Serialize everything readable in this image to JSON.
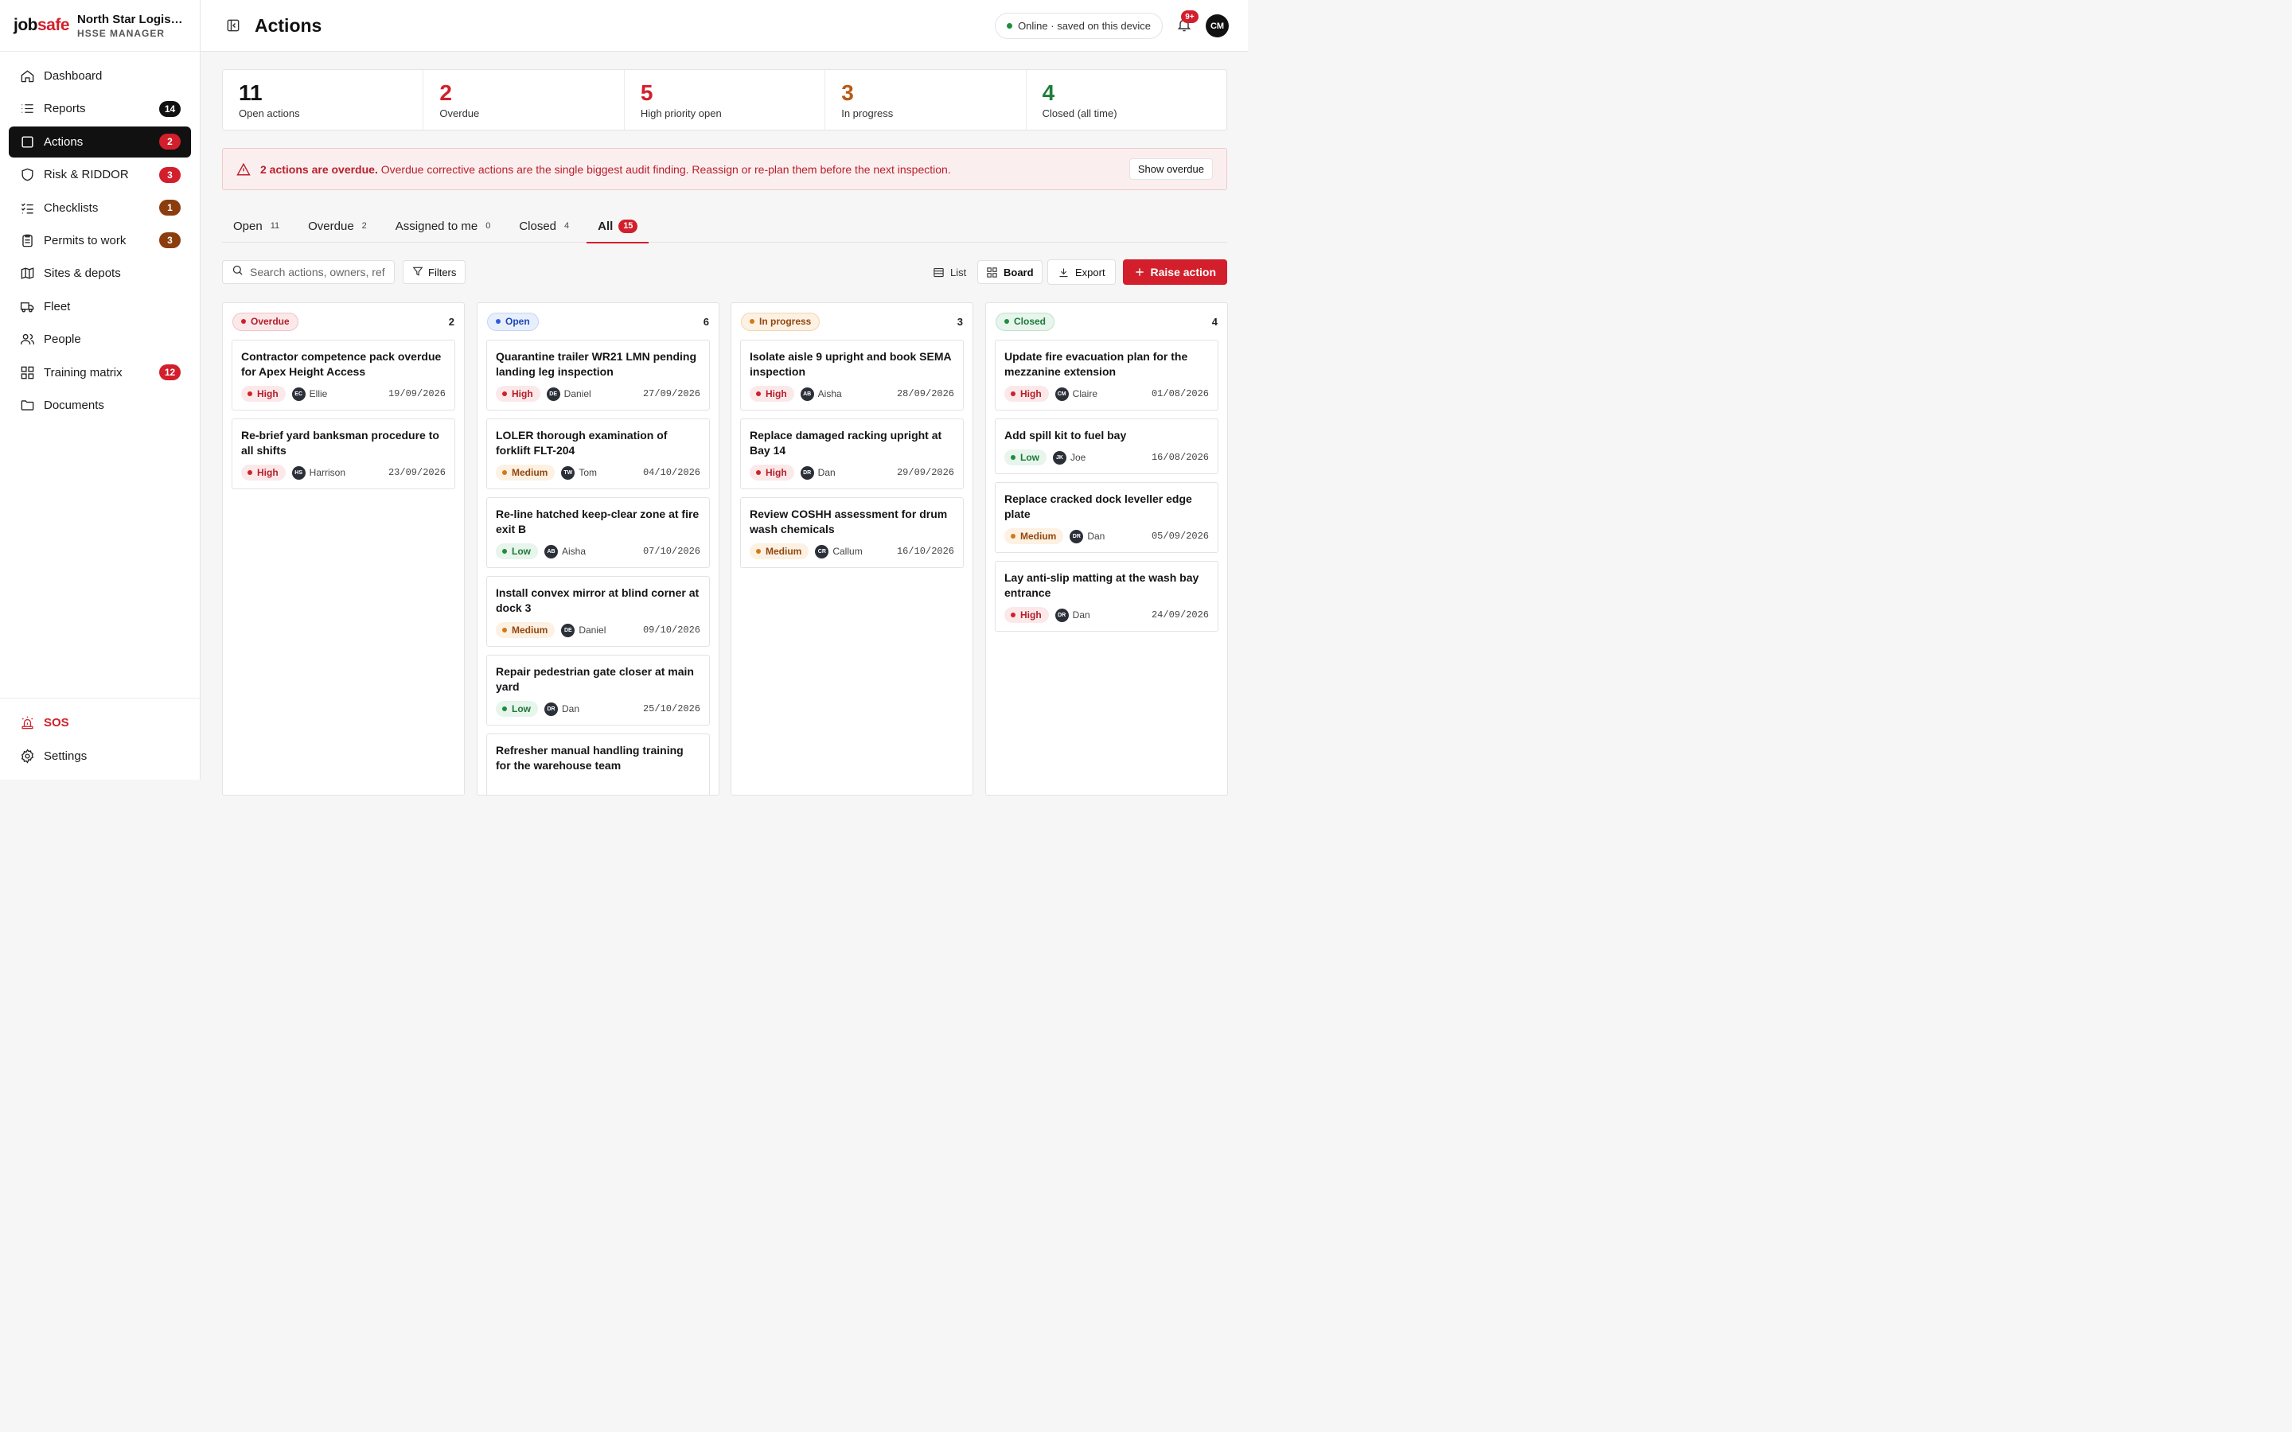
{
  "brand": {
    "logo_a": "job",
    "logo_b": "safe",
    "org_name": "North Star Logistics",
    "org_role": "HSSE MANAGER"
  },
  "nav": {
    "items": [
      {
        "label": "Dashboard",
        "badge": ""
      },
      {
        "label": "Reports",
        "badge": "14"
      },
      {
        "label": "Actions",
        "badge": "2"
      },
      {
        "label": "Risk & RIDDOR",
        "badge": "3"
      },
      {
        "label": "Checklists",
        "badge": "1"
      },
      {
        "label": "Permits to work",
        "badge": "3"
      },
      {
        "label": "Sites & depots",
        "badge": ""
      },
      {
        "label": "Fleet",
        "badge": ""
      },
      {
        "label": "People",
        "badge": ""
      },
      {
        "label": "Training matrix",
        "badge": "12"
      },
      {
        "label": "Documents",
        "badge": ""
      }
    ],
    "sos": "SOS",
    "settings": "Settings"
  },
  "topbar": {
    "title": "Actions",
    "status": "Online · saved on this device",
    "notif_count": "9+",
    "avatar": "CM"
  },
  "stats": [
    {
      "value": "11",
      "label": "Open actions"
    },
    {
      "value": "2",
      "label": "Overdue"
    },
    {
      "value": "5",
      "label": "High priority open"
    },
    {
      "value": "3",
      "label": "In progress"
    },
    {
      "value": "4",
      "label": "Closed (all time)"
    }
  ],
  "alert": {
    "bold": "2 actions are overdue.",
    "text": " Overdue corrective actions are the single biggest audit finding. Reassign or re-plan them before the next inspection.",
    "button": "Show overdue"
  },
  "tabs": [
    {
      "label": "Open",
      "count": "11"
    },
    {
      "label": "Overdue",
      "count": "2"
    },
    {
      "label": "Assigned to me",
      "count": "0"
    },
    {
      "label": "Closed",
      "count": "4"
    },
    {
      "label": "All",
      "count": "15"
    }
  ],
  "toolbar": {
    "search_placeholder": "Search actions, owners, ref",
    "filters": "Filters",
    "list": "List",
    "board": "Board",
    "export": "Export",
    "raise": "Raise action"
  },
  "columns": [
    {
      "status": "Overdue",
      "count": "2",
      "cards": [
        {
          "title": "Contractor competence pack overdue for Apex Height Access",
          "priority": "High",
          "initials": "EC",
          "owner": "Ellie",
          "due": "19/09/2026"
        },
        {
          "title": "Re-brief yard banksman procedure to all shifts",
          "priority": "High",
          "initials": "HS",
          "owner": "Harrison",
          "due": "23/09/2026"
        }
      ]
    },
    {
      "status": "Open",
      "count": "6",
      "cards": [
        {
          "title": "Quarantine trailer WR21 LMN pending landing leg inspection",
          "priority": "High",
          "initials": "DE",
          "owner": "Daniel",
          "due": "27/09/2026"
        },
        {
          "title": "LOLER thorough examination of forklift FLT-204",
          "priority": "Medium",
          "initials": "TW",
          "owner": "Tom",
          "due": "04/10/2026"
        },
        {
          "title": "Re-line hatched keep-clear zone at fire exit B",
          "priority": "Low",
          "initials": "AB",
          "owner": "Aisha",
          "due": "07/10/2026"
        },
        {
          "title": "Install convex mirror at blind corner at dock 3",
          "priority": "Medium",
          "initials": "DE",
          "owner": "Daniel",
          "due": "09/10/2026"
        },
        {
          "title": "Repair pedestrian gate closer at main yard",
          "priority": "Low",
          "initials": "DR",
          "owner": "Dan",
          "due": "25/10/2026"
        },
        {
          "title": "Refresher manual handling training for the warehouse team",
          "priority": "",
          "initials": "",
          "owner": "",
          "due": ""
        }
      ]
    },
    {
      "status": "In progress",
      "count": "3",
      "cards": [
        {
          "title": "Isolate aisle 9 upright and book SEMA inspection",
          "priority": "High",
          "initials": "AB",
          "owner": "Aisha",
          "due": "28/09/2026"
        },
        {
          "title": "Replace damaged racking upright at Bay 14",
          "priority": "High",
          "initials": "DR",
          "owner": "Dan",
          "due": "29/09/2026"
        },
        {
          "title": "Review COSHH assessment for drum wash chemicals",
          "priority": "Medium",
          "initials": "CR",
          "owner": "Callum",
          "due": "16/10/2026"
        }
      ]
    },
    {
      "status": "Closed",
      "count": "4",
      "cards": [
        {
          "title": "Update fire evacuation plan for the mezzanine extension",
          "priority": "High",
          "initials": "CM",
          "owner": "Claire",
          "due": "01/08/2026"
        },
        {
          "title": "Add spill kit to fuel bay",
          "priority": "Low",
          "initials": "JK",
          "owner": "Joe",
          "due": "16/08/2026"
        },
        {
          "title": "Replace cracked dock leveller edge plate",
          "priority": "Medium",
          "initials": "DR",
          "owner": "Dan",
          "due": "05/09/2026"
        },
        {
          "title": "Lay anti-slip matting at the wash bay entrance",
          "priority": "High",
          "initials": "DR",
          "owner": "Dan",
          "due": "24/09/2026"
        }
      ]
    }
  ],
  "colors": {
    "accent": "#d21f2b",
    "dark": "#111111",
    "overdue": "#d21f2b",
    "open": "#2f5bdb",
    "in_progress": "#d27a17",
    "closed": "#1e8e3e"
  }
}
